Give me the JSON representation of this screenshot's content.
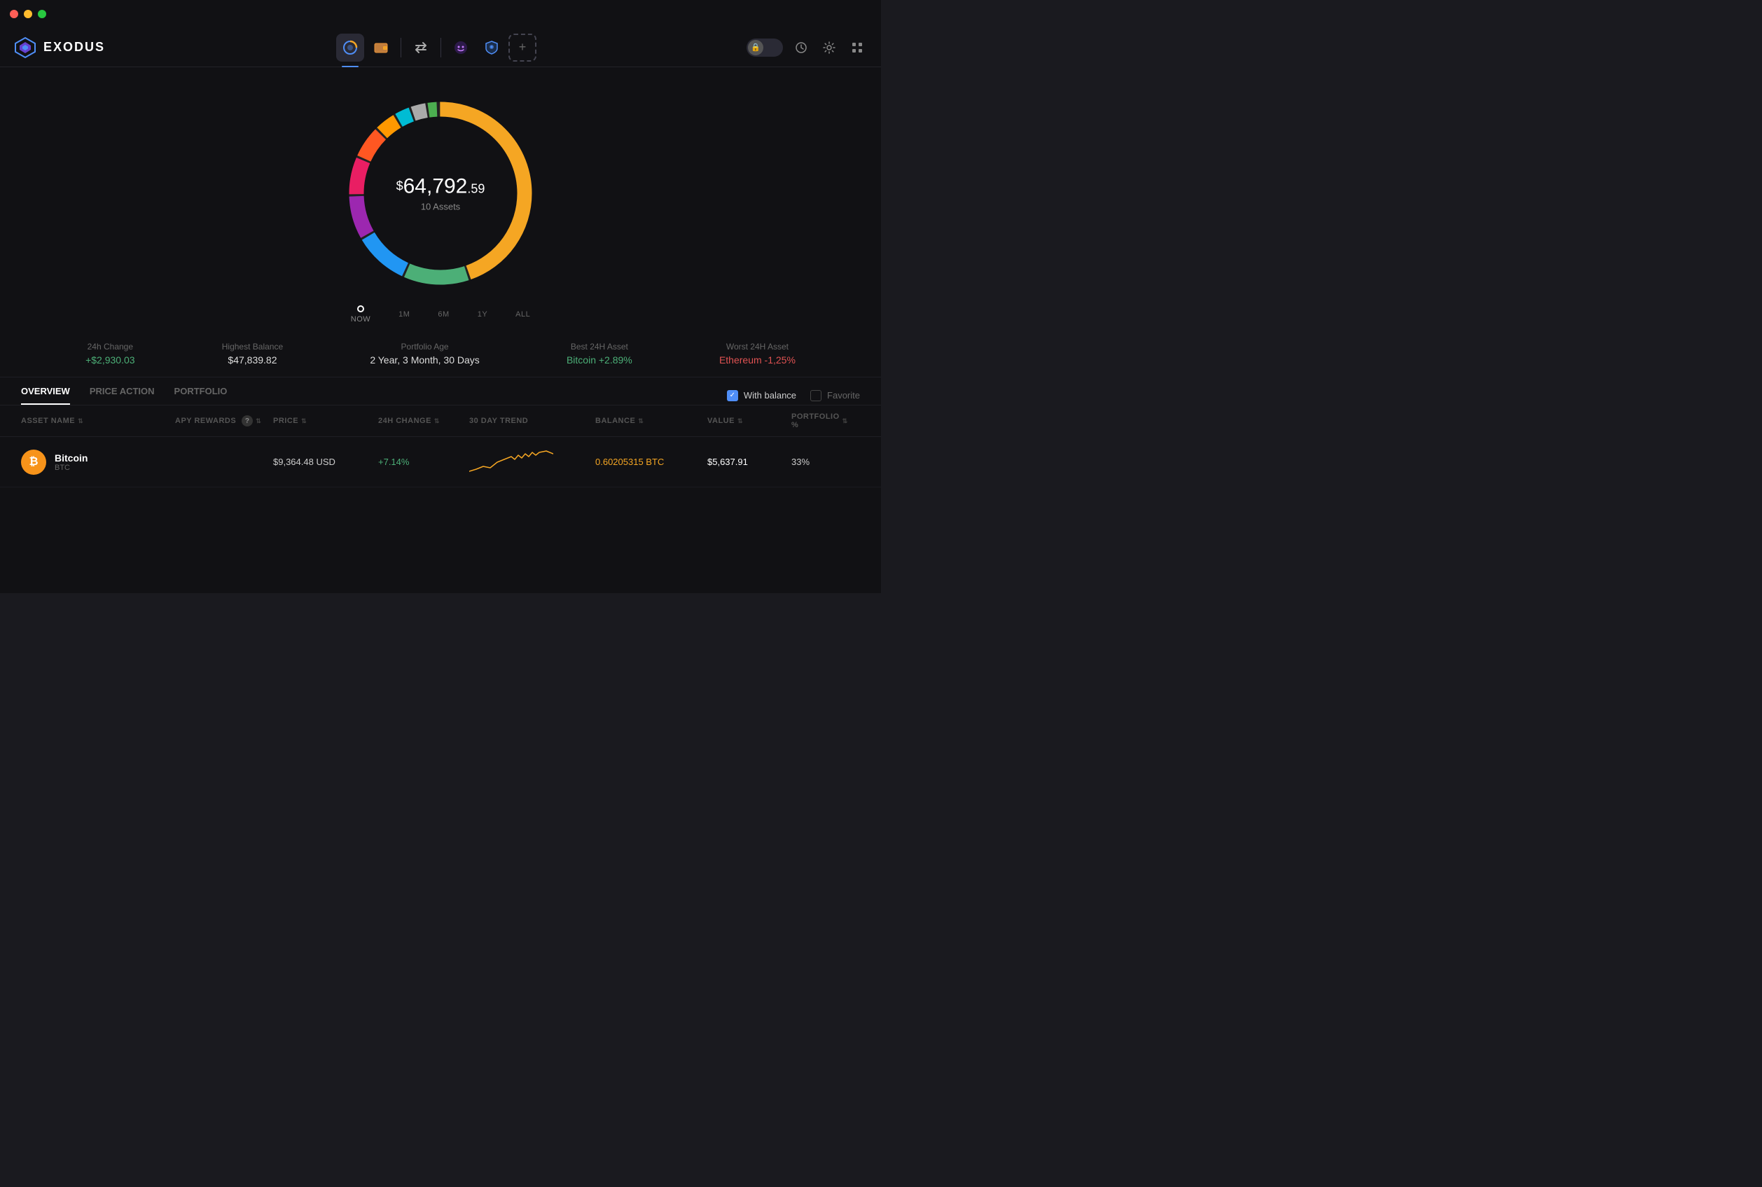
{
  "titlebar": {
    "traffic_lights": [
      "close",
      "minimize",
      "maximize"
    ]
  },
  "header": {
    "logo_text": "EXODUS",
    "nav_items": [
      {
        "id": "portfolio",
        "label": "Portfolio",
        "active": true
      },
      {
        "id": "wallet",
        "label": "Wallet",
        "active": false
      },
      {
        "id": "exchange",
        "label": "Exchange",
        "active": false
      },
      {
        "id": "app1",
        "label": "App1",
        "active": false
      },
      {
        "id": "app2",
        "label": "App2",
        "active": false
      }
    ],
    "add_label": "+",
    "right_icons": [
      "lock",
      "history",
      "settings",
      "apps"
    ]
  },
  "chart": {
    "amount_dollar": "$",
    "amount_main": "64,792",
    "amount_cents": ".59",
    "assets_label": "10 Assets"
  },
  "timeline": {
    "now_label": "NOW",
    "periods": [
      "1M",
      "6M",
      "1Y",
      "ALL"
    ]
  },
  "stats": [
    {
      "label": "24h Change",
      "value": "+$2,930.03"
    },
    {
      "label": "Highest Balance",
      "value": "$47,839.82"
    },
    {
      "label": "Portfolio Age",
      "value": "2 Year, 3 Month, 30 Days"
    },
    {
      "label": "Best 24H Asset",
      "value": "Bitcoin +2.89%"
    },
    {
      "label": "Worst 24H Asset",
      "value": "Ethereum -1,25%"
    }
  ],
  "tabs": {
    "items": [
      {
        "id": "overview",
        "label": "OVERVIEW",
        "active": true
      },
      {
        "id": "price-action",
        "label": "PRICE ACTION",
        "active": false
      },
      {
        "id": "portfolio",
        "label": "PORTFOLIO",
        "active": false
      }
    ],
    "with_balance_label": "With balance",
    "favorite_label": "Favorite"
  },
  "table": {
    "columns": [
      {
        "id": "asset-name",
        "label": "ASSET NAME",
        "sortable": true
      },
      {
        "id": "apy-rewards",
        "label": "APY REWARDS",
        "sortable": true,
        "has_help": true
      },
      {
        "id": "price",
        "label": "PRICE",
        "sortable": true
      },
      {
        "id": "24h-change",
        "label": "24H CHANGE",
        "sortable": true
      },
      {
        "id": "30-day-trend",
        "label": "30 DAY TREND",
        "sortable": false
      },
      {
        "id": "balance",
        "label": "BALANCE",
        "sortable": true
      },
      {
        "id": "value",
        "label": "VALUE",
        "sortable": true
      },
      {
        "id": "portfolio-pct",
        "label": "PORTFOLIO %",
        "sortable": true
      }
    ],
    "rows": [
      {
        "name": "Bitcoin",
        "ticker": "BTC",
        "icon_bg": "#f7931a",
        "icon_char": "₿",
        "apy": "",
        "price": "$9,364.48 USD",
        "change_24h": "+7.14%",
        "change_positive": true,
        "balance": "0.60205315 BTC",
        "value": "$5,637.91",
        "portfolio_pct": "33%"
      }
    ]
  },
  "colors": {
    "accent_blue": "#4f8ef7",
    "positive": "#4caf77",
    "negative": "#e05252",
    "btc_orange": "#f5a623",
    "bg_dark": "#111114",
    "bg_medium": "#1a1a1f"
  },
  "donut_segments": [
    {
      "color": "#f5a623",
      "pct": 45
    },
    {
      "color": "#4caf77",
      "pct": 12
    },
    {
      "color": "#2196f3",
      "pct": 10
    },
    {
      "color": "#9c27b0",
      "pct": 8
    },
    {
      "color": "#e91e63",
      "pct": 7
    },
    {
      "color": "#ff5722",
      "pct": 6
    },
    {
      "color": "#ff9800",
      "pct": 4
    },
    {
      "color": "#00bcd4",
      "pct": 3
    },
    {
      "color": "#aaa",
      "pct": 3
    },
    {
      "color": "#4caf50",
      "pct": 2
    }
  ]
}
